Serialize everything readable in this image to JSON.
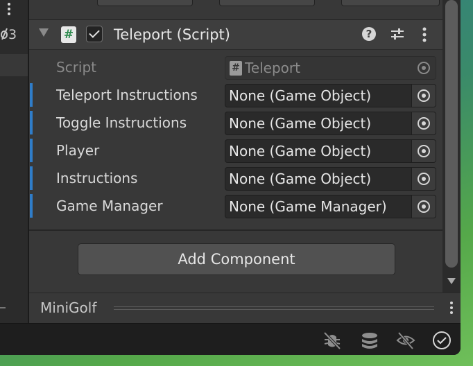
{
  "left_panel": {
    "count": "3"
  },
  "component": {
    "title": "Teleport (Script)",
    "enabled": true
  },
  "fields": [
    {
      "label": "Script",
      "value": "Teleport",
      "disabled": true
    },
    {
      "label": "Teleport Instructions",
      "value": "None (Game Object)",
      "disabled": false
    },
    {
      "label": "Toggle Instructions",
      "value": "None (Game Object)",
      "disabled": false
    },
    {
      "label": "Player",
      "value": "None (Game Object)",
      "disabled": false
    },
    {
      "label": "Instructions",
      "value": "None (Game Object)",
      "disabled": false
    },
    {
      "label": "Game Manager",
      "value": "None (Game Manager)",
      "disabled": false
    }
  ],
  "add_component_label": "Add Component",
  "footer": {
    "title": "MiniGolf"
  },
  "icons": {
    "script": "#",
    "help": "?"
  },
  "colors": {
    "override_marker": "#2f7dc9",
    "script_icon_green": "#2d8a4e"
  }
}
